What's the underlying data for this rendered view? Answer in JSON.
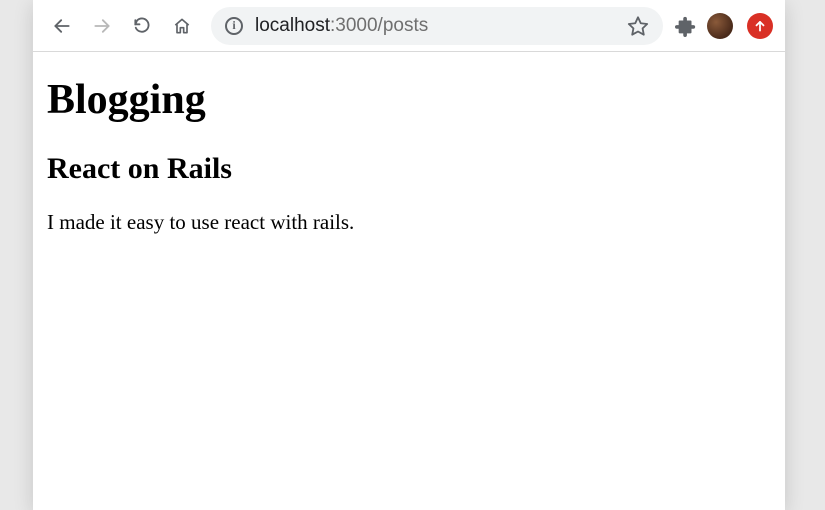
{
  "address": {
    "host": "localhost",
    "rest": ":3000/posts"
  },
  "page": {
    "heading": "Blogging",
    "post_title": "React on Rails",
    "post_body": "I made it easy to use react with rails."
  }
}
